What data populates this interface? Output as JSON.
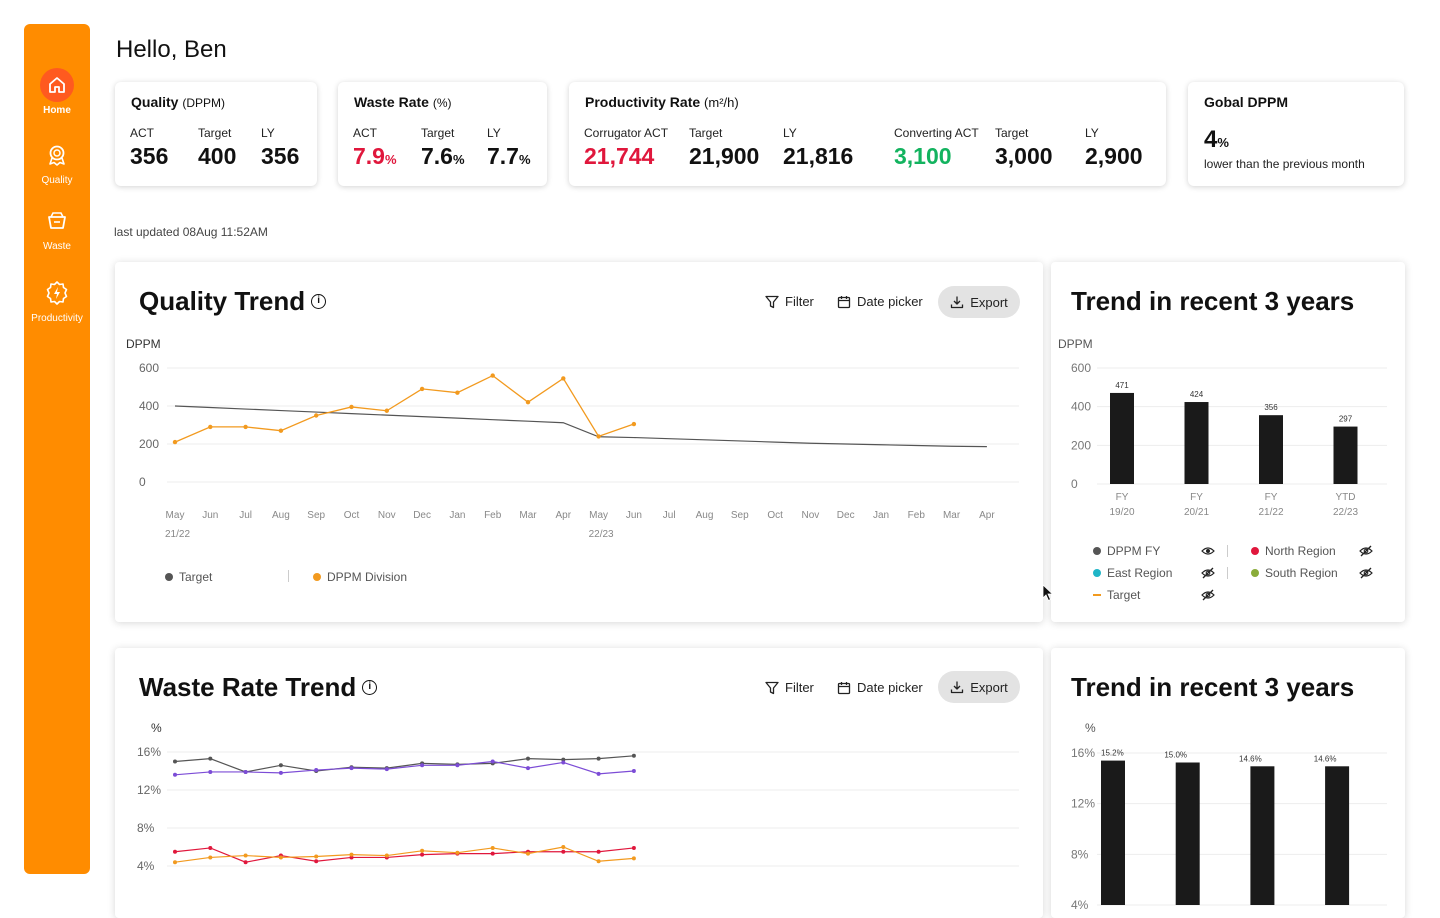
{
  "sidebar": {
    "items": [
      {
        "label": "Home",
        "icon": "home-icon",
        "active": true
      },
      {
        "label": "Quality",
        "icon": "award-icon"
      },
      {
        "label": "Waste",
        "icon": "waste-bin-icon"
      },
      {
        "label": "Productivity",
        "icon": "gear-bolt-icon"
      }
    ]
  },
  "greeting": "Hello, Ben",
  "kpis": {
    "quality": {
      "title": "Quality",
      "unit": "(DPPM)",
      "act_label": "ACT",
      "act": "356",
      "target_label": "Target",
      "target": "400",
      "ly_label": "LY",
      "ly": "356"
    },
    "waste": {
      "title": "Waste Rate",
      "unit": "(%)",
      "act_label": "ACT",
      "act": "7.9",
      "target_label": "Target",
      "target": "7.6",
      "ly_label": "LY",
      "ly": "7.7",
      "pct": "%"
    },
    "productivity": {
      "title": "Productivity Rate",
      "unit": "(m²/h)",
      "corr_label": "Corrugator ACT",
      "corr": "21,744",
      "t1_label": "Target",
      "t1": "21,900",
      "ly1_label": "LY",
      "ly1": "21,816",
      "conv_label": "Converting ACT",
      "conv": "3,100",
      "t2_label": "Target",
      "t2": "3,000",
      "ly2_label": "LY",
      "ly2": "2,900"
    },
    "dppm": {
      "title": "Gobal DPPM",
      "value": "4",
      "pct": "%",
      "note": "lower than the previous month"
    }
  },
  "last_updated": "last updated 08Aug 11:52AM",
  "toolbar": {
    "filter": "Filter",
    "date_picker": "Date picker",
    "export": "Export"
  },
  "quality_trend": {
    "title": "Quality Trend",
    "legend": {
      "target": "Target",
      "division": "DPPM Division"
    },
    "chart_data": {
      "type": "line",
      "ylabel": "DPPM",
      "ylim": [
        0,
        600
      ],
      "yticks": [
        "600",
        "400",
        "200",
        "0"
      ],
      "x": [
        "May",
        "Jun",
        "Jul",
        "Aug",
        "Sep",
        "Oct",
        "Nov",
        "Dec",
        "Jan",
        "Feb",
        "Mar",
        "Apr",
        "May",
        "Jun",
        "Jul",
        "Aug",
        "Sep",
        "Oct",
        "Nov",
        "Dec",
        "Jan",
        "Feb",
        "Mar",
        "Apr"
      ],
      "x_groups": [
        {
          "label": "21/22",
          "at": 0
        },
        {
          "label": "22/23",
          "at": 12
        }
      ],
      "series": [
        {
          "name": "Target",
          "color": "#555555",
          "values": [
            400,
            392,
            384,
            376,
            368,
            360,
            352,
            344,
            336,
            328,
            320,
            312,
            238,
            234,
            228,
            222,
            216,
            210,
            204,
            200,
            196,
            192,
            188,
            186
          ]
        },
        {
          "name": "DPPM Division",
          "color": "#f29a1f",
          "values": [
            210,
            290,
            290,
            270,
            350,
            395,
            375,
            490,
            470,
            560,
            420,
            545,
            240,
            305
          ]
        }
      ]
    }
  },
  "quality_recent": {
    "title": "Trend in recent 3 years",
    "chart_data": {
      "type": "bar",
      "ylabel": "DPPM",
      "ylim": [
        0,
        600
      ],
      "yticks": [
        "600",
        "400",
        "200",
        "0"
      ],
      "categories": [
        [
          "FY",
          "19/20"
        ],
        [
          "FY",
          "20/21"
        ],
        [
          "FY",
          "21/22"
        ],
        [
          "YTD",
          "22/23"
        ]
      ],
      "values": [
        471,
        424,
        356,
        297
      ],
      "labels": [
        "471",
        "424",
        "356",
        "297"
      ]
    },
    "legend": [
      {
        "label": "DPPM FY",
        "color": "#555555",
        "icon": "eye-icon"
      },
      {
        "label": "North Region",
        "color": "#e0173c",
        "icon": "eye-off-icon"
      },
      {
        "label": "East Region",
        "color": "#1fb5c7",
        "icon": "eye-off-icon"
      },
      {
        "label": "South Region",
        "color": "#8aac3a",
        "icon": "eye-off-icon"
      },
      {
        "label": "Target",
        "color": "#f29a1f",
        "icon": "eye-off-icon"
      }
    ]
  },
  "waste_trend": {
    "title": "Waste Rate Trend",
    "chart_data": {
      "type": "line",
      "ylabel": "%",
      "ylim": [
        0,
        16
      ],
      "yticks": [
        "16%",
        "12%",
        "8%",
        "4%"
      ],
      "series": [
        {
          "name": "",
          "color": "#555555",
          "values": [
            15.0,
            15.3,
            13.9,
            14.6,
            14.0,
            14.4,
            14.3,
            14.8,
            14.7,
            14.8,
            15.3,
            15.2,
            15.3,
            15.6
          ]
        },
        {
          "name": "",
          "color": "#7c4cd6",
          "values": [
            13.6,
            13.9,
            13.9,
            13.8,
            14.1,
            14.3,
            14.2,
            14.6,
            14.6,
            15.0,
            14.3,
            14.9,
            13.7,
            14.0
          ]
        },
        {
          "name": "",
          "color": "#e0173c",
          "values": [
            5.5,
            5.9,
            4.4,
            5.1,
            4.5,
            4.9,
            4.9,
            5.2,
            5.3,
            5.3,
            5.5,
            5.5,
            5.5,
            5.9
          ]
        },
        {
          "name": "",
          "color": "#f29a1f",
          "values": [
            4.4,
            4.9,
            5.1,
            4.9,
            5.0,
            5.2,
            5.1,
            5.6,
            5.4,
            5.9,
            5.3,
            6.0,
            4.5,
            4.8
          ]
        }
      ]
    }
  },
  "waste_recent": {
    "title": "Trend in recent 3 years",
    "chart_data": {
      "type": "bar",
      "ylabel": "%",
      "ylim": [
        0,
        16
      ],
      "yticks": [
        "16%",
        "12%",
        "8%",
        "4%"
      ],
      "values": [
        15.2,
        15.0,
        14.6,
        14.6
      ],
      "labels": [
        "15.2%",
        "15.0%",
        "14.6%",
        "14.6%"
      ]
    }
  }
}
